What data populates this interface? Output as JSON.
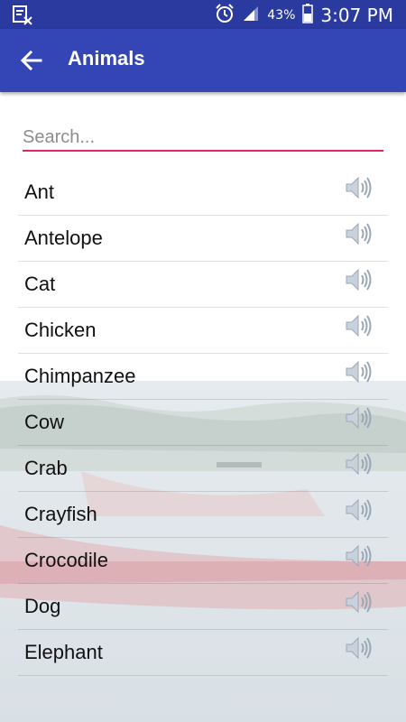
{
  "status_bar": {
    "battery": "43%",
    "time": "3:07 PM",
    "icons": [
      "text-notification-icon",
      "alarm-icon",
      "signal-icon",
      "battery-icon"
    ]
  },
  "app_bar": {
    "title": "Animals",
    "back_icon": "arrow-back-icon",
    "color": "#3446b5"
  },
  "search": {
    "placeholder": "Search...",
    "value": "",
    "underline_color": "#e2236c"
  },
  "animals": [
    {
      "label": "Ant"
    },
    {
      "label": "Antelope"
    },
    {
      "label": "Cat"
    },
    {
      "label": "Chicken"
    },
    {
      "label": "Chimpanzee"
    },
    {
      "label": "Cow"
    },
    {
      "label": "Crab"
    },
    {
      "label": "Crayfish"
    },
    {
      "label": "Crocodile"
    },
    {
      "label": "Dog"
    },
    {
      "label": "Elephant"
    }
  ],
  "row_icon": "speaker-icon"
}
